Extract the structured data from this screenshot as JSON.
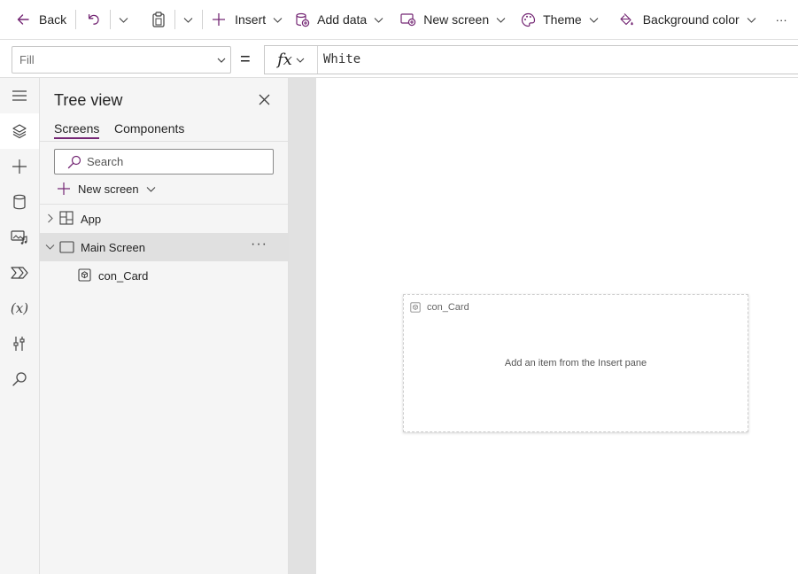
{
  "toolbar": {
    "back_label": "Back",
    "insert_label": "Insert",
    "add_data_label": "Add data",
    "new_screen_label": "New screen",
    "theme_label": "Theme",
    "background_color_label": "Background color",
    "more_label": "···"
  },
  "formula_bar": {
    "property": "Fill",
    "equals": "=",
    "fx_label": "fx",
    "formula": "White"
  },
  "left_rail": {
    "fx_label": "(x)"
  },
  "tree_view": {
    "title": "Tree view",
    "tabs": [
      {
        "label": "Screens",
        "active": true
      },
      {
        "label": "Components",
        "active": false
      }
    ],
    "search_placeholder": "Search",
    "new_screen_label": "New screen",
    "nodes": [
      {
        "label": "App",
        "icon": "app-grid-icon",
        "expanded": false
      },
      {
        "label": "Main Screen",
        "icon": "screen-icon",
        "expanded": true,
        "selected": true
      },
      {
        "label": "con_Card",
        "icon": "container-icon"
      }
    ],
    "more_label": "···"
  },
  "canvas": {
    "card_name": "con_Card",
    "card_hint": "Add an item from the Insert pane"
  },
  "colors": {
    "accent": "#742774",
    "rail_bg": "#f5f5f5",
    "selected_row": "#e0e0e0",
    "gutter": "#e1e1e1"
  }
}
